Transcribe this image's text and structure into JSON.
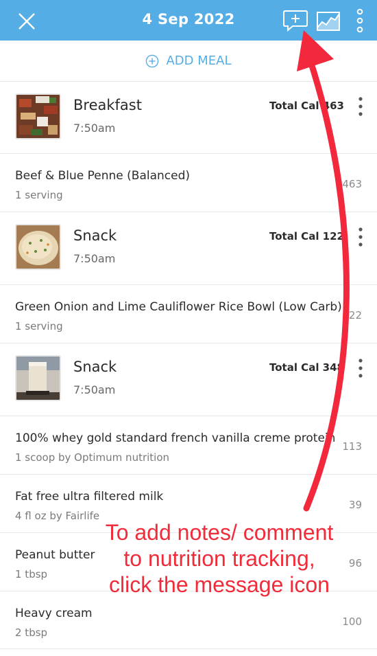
{
  "header": {
    "title": "4 Sep 2022",
    "background": "#55ade6",
    "icons": [
      "close-icon",
      "add-comment-icon",
      "trend-chart-icon",
      "more-vertical-icon"
    ]
  },
  "add_meal": {
    "label": "ADD MEAL",
    "icon": "plus-circle-icon"
  },
  "meals": [
    {
      "name": "Breakfast",
      "time": "7:50am",
      "total": "Total Cal 463",
      "items": [
        {
          "name": "Beef & Blue Penne (Balanced)",
          "serving": "1 serving",
          "cal": "463"
        }
      ]
    },
    {
      "name": "Snack",
      "time": "7:50am",
      "total": "Total Cal 122",
      "items": [
        {
          "name": "Green Onion and Lime Cauliflower Rice Bowl (Low Carb)",
          "serving": "1 serving",
          "cal": "122"
        }
      ]
    },
    {
      "name": "Snack",
      "time": "7:50am",
      "total": "Total Cal 348",
      "items": [
        {
          "name": "100% whey gold standard french vanilla creme protein",
          "serving": "1 scoop by Optimum nutrition",
          "cal": "113"
        },
        {
          "name": "Fat free ultra filtered milk",
          "serving": "4 fl oz by Fairlife",
          "cal": "39"
        },
        {
          "name": "Peanut butter",
          "serving": "1 tbsp",
          "cal": "96"
        },
        {
          "name": "Heavy cream",
          "serving": "2 tbsp",
          "cal": "100"
        }
      ]
    }
  ],
  "annotation": {
    "text": "To add notes/ comment to nutrition tracking, click the message icon",
    "color": "#f02b3a"
  }
}
